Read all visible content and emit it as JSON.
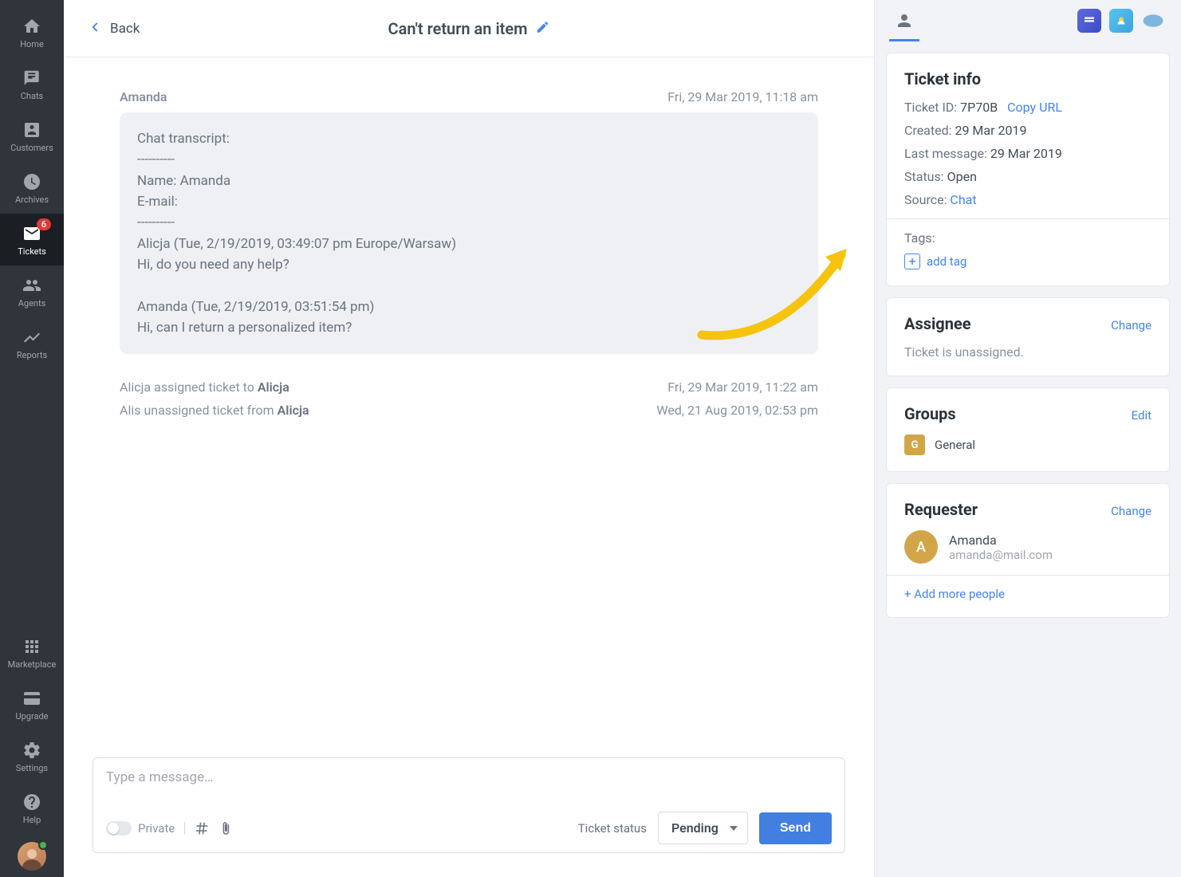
{
  "sidebar": {
    "items": [
      {
        "label": "Home",
        "icon": "home"
      },
      {
        "label": "Chats",
        "icon": "chats"
      },
      {
        "label": "Customers",
        "icon": "customers"
      },
      {
        "label": "Archives",
        "icon": "archives"
      },
      {
        "label": "Tickets",
        "icon": "tickets",
        "badge": "6",
        "active": true
      },
      {
        "label": "Agents",
        "icon": "agents"
      },
      {
        "label": "Reports",
        "icon": "reports"
      }
    ],
    "bottom": [
      {
        "label": "Marketplace",
        "icon": "grid"
      },
      {
        "label": "Upgrade",
        "icon": "upgrade"
      },
      {
        "label": "Settings",
        "icon": "gear"
      },
      {
        "label": "Help",
        "icon": "help"
      }
    ]
  },
  "header": {
    "back_label": "Back",
    "title": "Can't return an item"
  },
  "conversation": {
    "message": {
      "author": "Amanda",
      "time": "Fri, 29 Mar 2019, 11:18 am",
      "transcript": "Chat transcript:\n----------\nName: Amanda\nE-mail:\n----------\nAlicja (Tue, 2/19/2019, 03:49:07 pm Europe/Warsaw)\nHi, do you need any help?\n\nAmanda (Tue, 2/19/2019, 03:51:54 pm)\nHi, can I return a personalized item?"
    },
    "events": [
      {
        "text_before": "Alicja assigned ticket to ",
        "subject": "Alicja",
        "time": "Fri, 29 Mar 2019, 11:22 am"
      },
      {
        "text_before": "Alis unassigned ticket from ",
        "subject": "Alicja",
        "time": "Wed, 21 Aug 2019, 02:53 pm"
      }
    ]
  },
  "composer": {
    "placeholder": "Type a message…",
    "private_label": "Private",
    "status_label": "Ticket status",
    "status_value": "Pending",
    "send_label": "Send"
  },
  "right": {
    "ticket_info": {
      "title": "Ticket info",
      "id_label": "Ticket ID:",
      "id_value": "7P70B",
      "copy_url": "Copy URL",
      "created_label": "Created:",
      "created_value": "29 Mar 2019",
      "last_msg_label": "Last message:",
      "last_msg_value": "29 Mar 2019",
      "status_label": "Status:",
      "status_value": "Open",
      "source_label": "Source:",
      "source_value": "Chat",
      "tags_label": "Tags:",
      "add_tag_label": "add tag"
    },
    "assignee": {
      "title": "Assignee",
      "action": "Change",
      "body": "Ticket is unassigned."
    },
    "groups": {
      "title": "Groups",
      "action": "Edit",
      "badge_letter": "G",
      "name": "General"
    },
    "requester": {
      "title": "Requester",
      "action": "Change",
      "avatar_letter": "A",
      "name": "Amanda",
      "email": "amanda@mail.com",
      "add_more": "+ Add more people"
    }
  }
}
